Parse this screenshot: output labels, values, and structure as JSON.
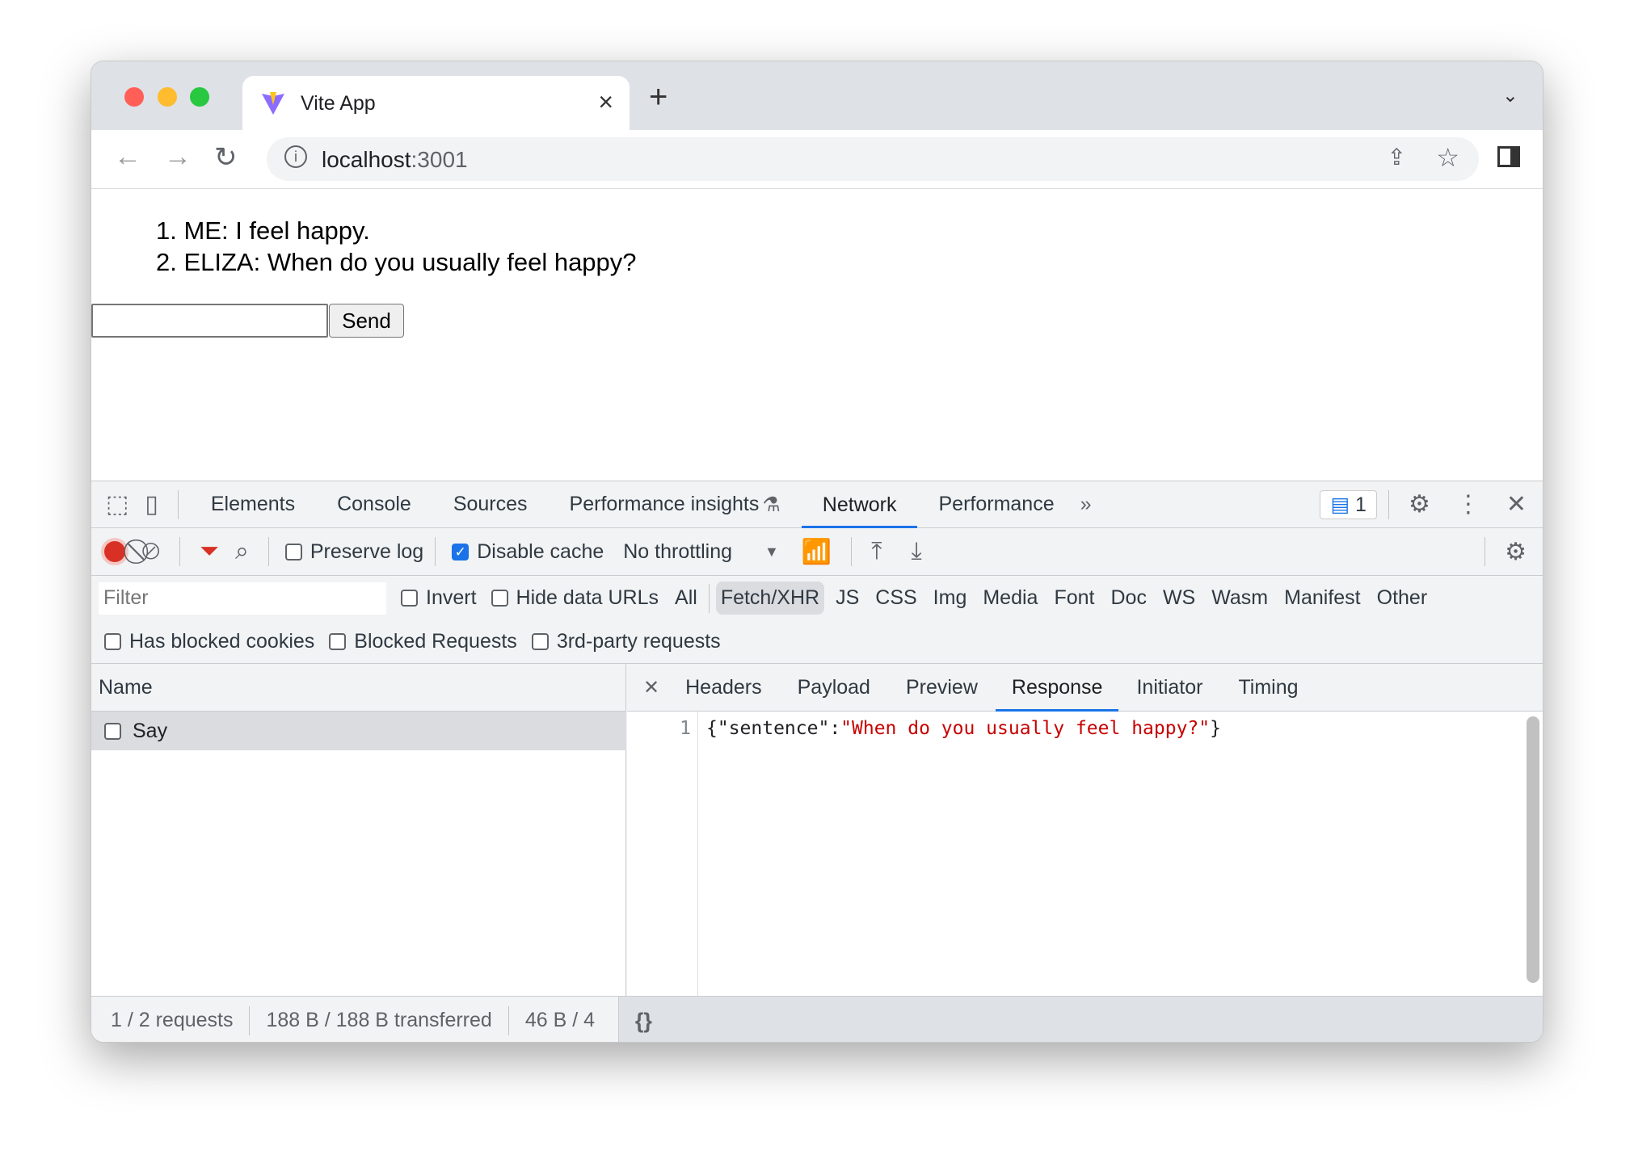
{
  "browser": {
    "tab_title": "Vite App",
    "url_host": "localhost",
    "url_port": ":3001",
    "traffic_colors": [
      "#ff5f57",
      "#febc2e",
      "#28c840"
    ]
  },
  "page": {
    "messages": [
      "ME: I feel happy.",
      "ELIZA: When do you usually feel happy?"
    ],
    "input_value": "",
    "send_label": "Send"
  },
  "devtools": {
    "tabs": [
      "Elements",
      "Console",
      "Sources",
      "Performance insights",
      "Network",
      "Performance"
    ],
    "active_tab": "Network",
    "issues_count": "1",
    "toolbar": {
      "preserve_log": "Preserve log",
      "disable_cache": "Disable cache",
      "throttling": "No throttling"
    },
    "filter": {
      "placeholder": "Filter",
      "invert": "Invert",
      "hide_data_urls": "Hide data URLs",
      "types": [
        "All",
        "Fetch/XHR",
        "JS",
        "CSS",
        "Img",
        "Media",
        "Font",
        "Doc",
        "WS",
        "Wasm",
        "Manifest",
        "Other"
      ],
      "active_type": "Fetch/XHR"
    },
    "checks": [
      "Has blocked cookies",
      "Blocked Requests",
      "3rd-party requests"
    ],
    "name_header": "Name",
    "requests": [
      "Say"
    ],
    "detail_tabs": [
      "Headers",
      "Payload",
      "Preview",
      "Response",
      "Initiator",
      "Timing"
    ],
    "active_detail": "Response",
    "response": {
      "line_no": "1",
      "prefix": "{\"sentence\":",
      "value": "\"When do you usually feel happy?\"",
      "suffix": "}"
    },
    "status": {
      "requests": "1 / 2 requests",
      "transferred": "188 B / 188 B transferred",
      "resources": "46 B / 4"
    },
    "accent": "#1a73e8"
  }
}
